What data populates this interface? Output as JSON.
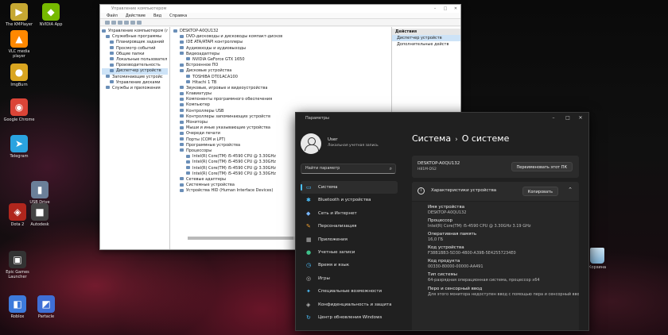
{
  "desktop": {
    "icons": [
      {
        "label": "The KMPlayer",
        "color": "#c6a832",
        "glyph": "▶"
      },
      {
        "label": "NVIDIA App",
        "color": "#76b900",
        "glyph": "◆"
      },
      {
        "label": "VLC media player",
        "color": "#ff8800",
        "glyph": "▲"
      },
      {
        "label": "ImgBurn",
        "color": "#d9a520",
        "glyph": "●"
      },
      {
        "label": "Google Chrome",
        "color": "#db4437",
        "glyph": "◉"
      },
      {
        "label": "Telegram",
        "color": "#2aa3e0",
        "glyph": "➤"
      },
      {
        "label": "USB Drive",
        "color": "#6b7f99",
        "glyph": "▮"
      },
      {
        "label": "Dota 2",
        "color": "#b0261d",
        "glyph": "◈"
      },
      {
        "label": "Autodesk",
        "color": "#444444",
        "glyph": "■"
      },
      {
        "label": "Epic Games Launcher",
        "color": "#333333",
        "glyph": "▣"
      },
      {
        "label": "Roblox",
        "color": "#3d7adb",
        "glyph": "◧"
      },
      {
        "label": "Partacle",
        "color": "#3f6fd6",
        "glyph": "◩"
      }
    ],
    "recycle_bin": {
      "label": "Корзина",
      "icon": "recycle-bin-icon"
    }
  },
  "device_manager": {
    "title": "Управление компьютером",
    "menu": [
      "Файл",
      "Действие",
      "Вид",
      "Справка"
    ],
    "left_tree": [
      "Управление компьютером (локал",
      "Служебные программы",
      "Планировщик заданий",
      "Просмотр событий",
      "Общие папки",
      "Локальные пользовател",
      "Производительность",
      "Диспетчер устройств",
      "Запоминающие устройс",
      "Управление дисками",
      "Службы и приложения"
    ],
    "device_tree": [
      "DESKTOP-A0QU132",
      "DVD-дисководы и дисководы компакт-дисков",
      "IDE ATA/ATAPI контроллеры",
      "Аудиовходы и аудиовыходы",
      "Видеоадаптеры",
      "NVIDIA GeForce GTX 1650",
      "Встроенное ПО",
      "Дисковые устройства",
      "TOSHIBA DT01ACA100",
      "Hitachi 1 TB",
      "Звуковые, игровые и видеоустройства",
      "Клавиатуры",
      "Компоненты программного обеспечения",
      "Компьютер",
      "Контроллеры USB",
      "Контроллеры запоминающих устройств",
      "Мониторы",
      "Мыши и иные указывающие устройства",
      "Очереди печати",
      "Порты (COM и LPT)",
      "Программные устройства",
      "Процессоры",
      "Intel(R) Core(TM) i5-4590 CPU @ 3.30GHz",
      "Intel(R) Core(TM) i5-4590 CPU @ 3.30GHz",
      "Intel(R) Core(TM) i5-4590 CPU @ 3.30GHz",
      "Intel(R) Core(TM) i5-4590 CPU @ 3.30GHz",
      "Сетевые адаптеры",
      "Системные устройства",
      "Устройства HID (Human Interface Devices)"
    ],
    "actions_title": "Действия",
    "actions": [
      "Диспетчер устройств",
      "Дополнительные действ"
    ]
  },
  "settings": {
    "title": "Параметры",
    "user": {
      "name": "User",
      "subtitle": "Локальная учетная запись"
    },
    "search_placeholder": "Найти параметр",
    "nav": [
      {
        "label": "Система",
        "glyph": "▭",
        "color": "#4cc2ff"
      },
      {
        "label": "Bluetooth и устройства",
        "glyph": "✱",
        "color": "#4cc2ff"
      },
      {
        "label": "Сеть и Интернет",
        "glyph": "◆",
        "color": "#79b8ff"
      },
      {
        "label": "Персонализация",
        "glyph": "✎",
        "color": "#f0a030"
      },
      {
        "label": "Приложения",
        "glyph": "▦",
        "color": "#bbbbbb"
      },
      {
        "label": "Учетные записи",
        "glyph": "●",
        "color": "#3fc18a"
      },
      {
        "label": "Время и язык",
        "glyph": "◷",
        "color": "#4cc2ff"
      },
      {
        "label": "Игры",
        "glyph": "◎",
        "color": "#bbbbbb"
      },
      {
        "label": "Специальные возможности",
        "glyph": "✦",
        "color": "#4cc2ff"
      },
      {
        "label": "Конфиденциальность и защита",
        "glyph": "◈",
        "color": "#bbbbbb"
      },
      {
        "label": "Центр обновления Windows",
        "glyph": "↻",
        "color": "#4cc2ff"
      }
    ],
    "breadcrumb": {
      "parent": "Система",
      "current": "О системе"
    },
    "pc": {
      "name": "DESKTOP-A0QU132",
      "model": "H81M-DS2",
      "rename_button": "Переименовать этот ПК"
    },
    "specs": {
      "title": "Характеристики устройства",
      "copy_button": "Копировать",
      "items": [
        {
          "k": "Имя устройства",
          "v": "DESKTOP-A0QU132"
        },
        {
          "k": "Процессор",
          "v": "Intel(R) Core(TM) i5-4590 CPU @ 3.30GHz   3.19 GHz"
        },
        {
          "k": "Оперативная память",
          "v": "16,0 ГБ"
        },
        {
          "k": "Код устройства",
          "v": "F38B1BB3-5D30-4B00-A39B-5E42557234E0"
        },
        {
          "k": "Код продукта",
          "v": "00330-80000-00000-AA491"
        },
        {
          "k": "Тип системы",
          "v": "64-разрядная операционная система, процессор x64"
        },
        {
          "k": "Перо и сенсорный ввод",
          "v": "Для этого монитора недоступен ввод с помощью пера и сенсорный ввод"
        }
      ]
    }
  }
}
